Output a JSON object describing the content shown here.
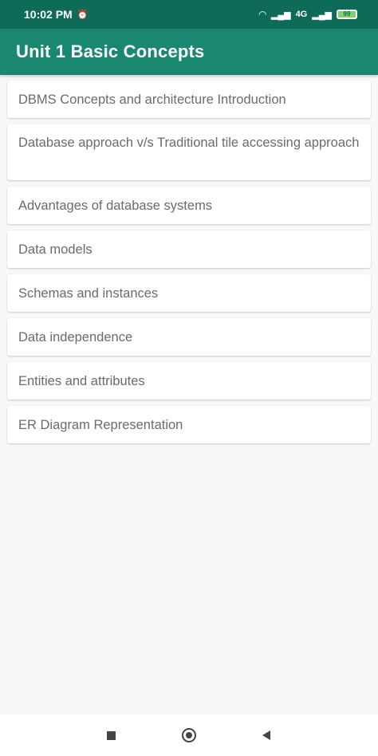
{
  "status_bar": {
    "time": "10:02 PM",
    "network": "4G",
    "battery": "99"
  },
  "app_bar": {
    "title": "Unit 1 Basic Concepts"
  },
  "topics": [
    "DBMS Concepts and architecture Introduction",
    "Database approach v/s Traditional tile accessing approach",
    "Advantages of database systems",
    "Data models",
    "Schemas and instances",
    "Data independence",
    "Entities and attributes",
    "ER Diagram Representation"
  ],
  "colors": {
    "status_bar": "#0d6b57",
    "app_bar": "#1a8870",
    "background": "#f8f8f8"
  }
}
